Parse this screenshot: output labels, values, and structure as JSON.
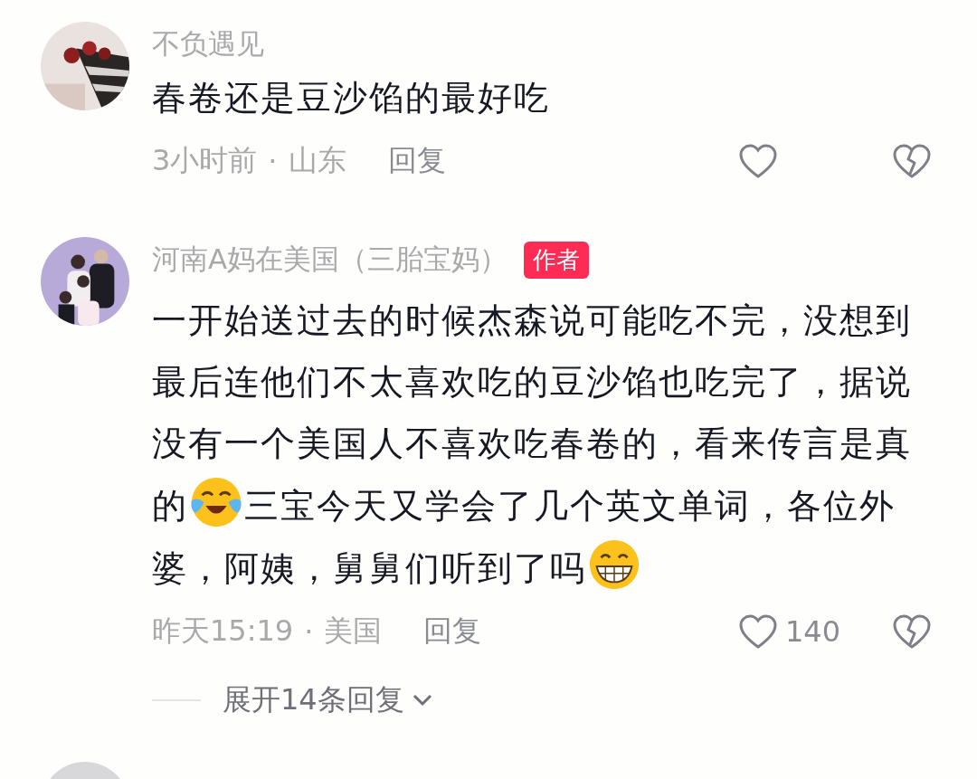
{
  "comments": [
    {
      "avatar": {
        "kind": "picture"
      },
      "user": "不负遇见",
      "body": [
        {
          "kind": "text",
          "text": "春卷还是豆沙馅的最好吃"
        }
      ],
      "time": "3小时前",
      "separator": "·",
      "location": "山东",
      "reply": "回复",
      "liked": false,
      "disliked": false
    },
    {
      "avatar": {
        "kind": "picture"
      },
      "user": "河南A妈在美国（三胎宝妈）",
      "badge": "作者",
      "body": [
        {
          "kind": "text",
          "text": "一开始送过去的时候杰森说可能吃不完，没想到最后连他们不太喜欢吃的豆沙馅也吃完了，据说没有一个美国人不喜欢吃春卷的，看来传言是真的"
        },
        {
          "kind": "laughing"
        },
        {
          "kind": "text",
          "text": "三宝今天又学会了几个英文单词，各位外婆，阿姨，舅舅们听到了吗"
        },
        {
          "kind": "grinning"
        }
      ],
      "time": "昨天15:19",
      "separator": "·",
      "location": "美国",
      "reply": "回复",
      "liked": false,
      "likes": "140",
      "disliked": false,
      "expand": "展开14条回复"
    },
    {
      "avatar": {
        "kind": "picture"
      }
    }
  ]
}
